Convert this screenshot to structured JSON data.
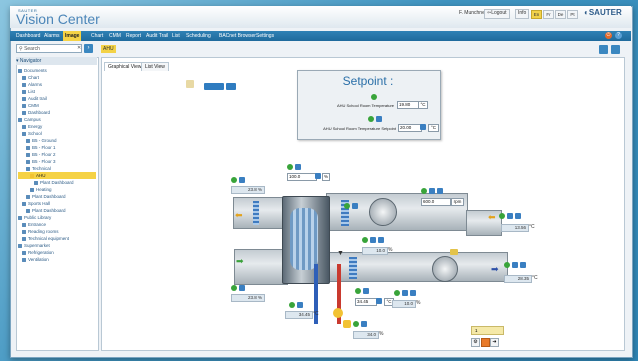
{
  "app": {
    "brand_small": "SAUTER",
    "brand": "Vision Center",
    "logo": "SAUTER"
  },
  "user": {
    "name": "F. Munchner",
    "logout": "Logout",
    "info": "Info"
  },
  "languages": [
    {
      "code": "En",
      "active": true
    },
    {
      "code": "Fr",
      "active": false
    },
    {
      "code": "De",
      "active": false
    },
    {
      "code": "Pt",
      "active": false
    }
  ],
  "menu": [
    {
      "label": "Dashboard",
      "active": false
    },
    {
      "label": "Alarms",
      "active": false
    },
    {
      "label": "Image",
      "active": true
    },
    {
      "label": "Chart",
      "active": false
    },
    {
      "label": "CMM",
      "active": false
    },
    {
      "label": "Report",
      "active": false
    },
    {
      "label": "Audit Trail",
      "active": false
    },
    {
      "label": "List",
      "active": false
    },
    {
      "label": "Scheduling",
      "active": false
    },
    {
      "label": "BACnet Browser",
      "active": false
    },
    {
      "label": "Settings",
      "active": false
    }
  ],
  "search": {
    "placeholder": "Search"
  },
  "breadcrumb": "AHU",
  "navigator": {
    "title": "Navigator",
    "items": [
      {
        "label": "Documents",
        "level": 0
      },
      {
        "label": "Chart",
        "level": 1
      },
      {
        "label": "Alarms",
        "level": 1
      },
      {
        "label": "List",
        "level": 1
      },
      {
        "label": "Audit trail",
        "level": 1
      },
      {
        "label": "CMM",
        "level": 1
      },
      {
        "label": "Dashboard",
        "level": 1
      },
      {
        "label": "Campus",
        "level": 0
      },
      {
        "label": "Energy",
        "level": 1
      },
      {
        "label": "School",
        "level": 1
      },
      {
        "label": "B5 - Ground",
        "level": 2
      },
      {
        "label": "B5 - Floor 1",
        "level": 2
      },
      {
        "label": "B5 - Floor 2",
        "level": 2
      },
      {
        "label": "B5 - Floor 3",
        "level": 2
      },
      {
        "label": "Technical",
        "level": 2
      },
      {
        "label": "AHU",
        "level": 3,
        "selected": true
      },
      {
        "label": "Plant Dashboard",
        "level": 4
      },
      {
        "label": "Heating",
        "level": 3
      },
      {
        "label": "Plant Dashboard",
        "level": 2
      },
      {
        "label": "Sports Hall",
        "level": 1
      },
      {
        "label": "Plant Dashboard",
        "level": 2
      },
      {
        "label": "Public Library",
        "level": 0
      },
      {
        "label": "Entrance",
        "level": 1
      },
      {
        "label": "Reading rooms",
        "level": 1
      },
      {
        "label": "Technical equipment",
        "level": 1
      },
      {
        "label": "Supermarket",
        "level": 0
      },
      {
        "label": "Refrigeration",
        "level": 1
      },
      {
        "label": "Ventilation",
        "level": 1
      }
    ]
  },
  "tabs": [
    {
      "label": "Graphical View",
      "active": true
    },
    {
      "label": "List View",
      "active": false
    }
  ],
  "setpoint": {
    "title": "Setpoint :",
    "row1_label": "AHU School Room Temperature",
    "row1_value": "19.80",
    "row1_unit": "°C",
    "row2_label": "AHU School Room Temperature Setpoint",
    "row2_value": "20.00",
    "row2_unit": "°C"
  },
  "diagram": {
    "damper_pct": "23.8",
    "damper_pct_unit": "%",
    "fan_left_value": "100.0",
    "fan_left_unit": "%",
    "fan_right_value": "600.0",
    "fan_right_unit": "rpm",
    "valve_pct": "10.0",
    "valve_pct_unit": "%",
    "supply_temp": "13.56",
    "supply_temp_unit": "°C",
    "exhaust_temp": "28.35",
    "exhaust_temp_unit": "°C",
    "bottom_damper_pct": "23.8",
    "bottom_damper_pct_unit": "%",
    "coil_temp": "34.45",
    "coil_temp_unit": "°C",
    "coil_sp": "34.45",
    "coil_sp_unit": "°C",
    "coil_valve_pct": "34.0",
    "coil_valve_pct_unit": "%",
    "right_fan_pct": "10.0",
    "right_fan_pct_unit": "%"
  },
  "pager": {
    "value": "1"
  },
  "colors": {
    "accent": "#f5d245",
    "menu": "#1f6a9c",
    "brand": "#4c86b8",
    "ok": "#39a43a"
  }
}
